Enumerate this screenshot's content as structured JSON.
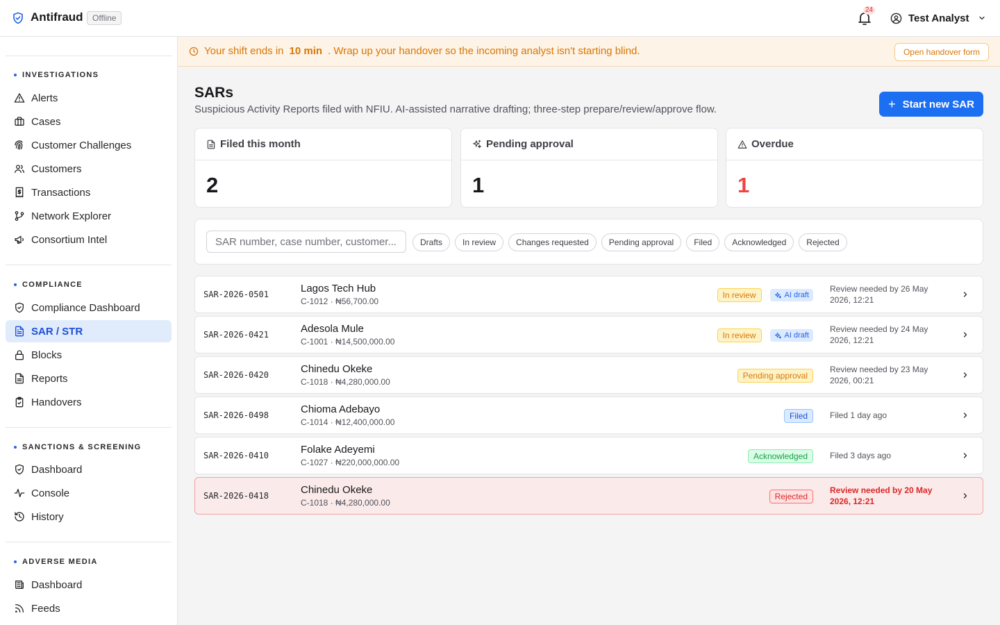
{
  "app": {
    "name": "Antifraud",
    "status_badge": "Offline"
  },
  "header": {
    "notification_count": "24",
    "user_name": "Test Analyst"
  },
  "sidebar": {
    "sections": [
      {
        "title": "INVESTIGATIONS",
        "items": [
          {
            "label": "Alerts",
            "icon": "alert-triangle-icon"
          },
          {
            "label": "Cases",
            "icon": "briefcase-icon"
          },
          {
            "label": "Customer Challenges",
            "icon": "fingerprint-icon"
          },
          {
            "label": "Customers",
            "icon": "users-icon"
          },
          {
            "label": "Transactions",
            "icon": "receipt-dollar-icon"
          },
          {
            "label": "Network Explorer",
            "icon": "git-branch-icon"
          },
          {
            "label": "Consortium Intel",
            "icon": "megaphone-icon"
          }
        ]
      },
      {
        "title": "COMPLIANCE",
        "items": [
          {
            "label": "Compliance Dashboard",
            "icon": "shield-check-icon"
          },
          {
            "label": "SAR / STR",
            "icon": "file-text-icon",
            "active": true
          },
          {
            "label": "Blocks",
            "icon": "lock-icon"
          },
          {
            "label": "Reports",
            "icon": "file-lines-icon"
          },
          {
            "label": "Handovers",
            "icon": "clipboard-check-icon"
          }
        ]
      },
      {
        "title": "SANCTIONS & SCREENING",
        "items": [
          {
            "label": "Dashboard",
            "icon": "shield-check-icon"
          },
          {
            "label": "Console",
            "icon": "activity-icon"
          },
          {
            "label": "History",
            "icon": "history-icon"
          }
        ]
      },
      {
        "title": "ADVERSE MEDIA",
        "items": [
          {
            "label": "Dashboard",
            "icon": "newspaper-icon"
          },
          {
            "label": "Feeds",
            "icon": "rss-icon"
          }
        ]
      }
    ]
  },
  "banner": {
    "text_before": "Your shift ends in",
    "highlight": "10 min",
    "text_after": ". Wrap up your handover so the incoming analyst isn't starting blind.",
    "button": "Open handover form"
  },
  "page": {
    "title": "SARs",
    "subtitle": "Suspicious Activity Reports filed with NFIU. AI-assisted narrative drafting; three-step prepare/review/approve flow.",
    "new_button": "Start new SAR"
  },
  "stats": [
    {
      "label": "Filed this month",
      "value": "2",
      "icon": "file-icon"
    },
    {
      "label": "Pending approval",
      "value": "1",
      "icon": "sparkles-icon"
    },
    {
      "label": "Overdue",
      "value": "1",
      "icon": "alert-triangle-icon",
      "color": "#ef4444"
    }
  ],
  "filters": {
    "search_placeholder": "SAR number, case number, customer...",
    "chips": [
      "Drafts",
      "In review",
      "Changes requested",
      "Pending approval",
      "Filed",
      "Acknowledged",
      "Rejected"
    ]
  },
  "sars": [
    {
      "number": "SAR-2026-0501",
      "customer": "Lagos Tech Hub",
      "meta": "C-1012 · ₦56,700.00",
      "status": "In review",
      "ai": "AI draft",
      "when": "Review needed by 26 May 2026, 12:21"
    },
    {
      "number": "SAR-2026-0421",
      "customer": "Adesola Mule",
      "meta": "C-1001 · ₦14,500,000.00",
      "status": "In review",
      "ai": "AI draft",
      "when": "Review needed by 24 May 2026, 12:21"
    },
    {
      "number": "SAR-2026-0420",
      "customer": "Chinedu Okeke",
      "meta": "C-1018 · ₦4,280,000.00",
      "status": "Pending approval",
      "ai": "",
      "when": "Review needed by 23 May 2026, 00:21"
    },
    {
      "number": "SAR-2026-0498",
      "customer": "Chioma Adebayo",
      "meta": "C-1014 · ₦12,400,000.00",
      "status": "Filed",
      "ai": "",
      "when": "Filed 1 day ago"
    },
    {
      "number": "SAR-2026-0410",
      "customer": "Folake Adeyemi",
      "meta": "C-1027 · ₦220,000,000.00",
      "status": "Acknowledged",
      "ai": "",
      "when": "Filed 3 days ago"
    },
    {
      "number": "SAR-2026-0418",
      "customer": "Chinedu Okeke",
      "meta": "C-1018 · ₦4,280,000.00",
      "status": "Rejected",
      "ai": "",
      "when": "Review needed by 20 May 2026, 12:21"
    }
  ],
  "colors": {
    "accent": "#1d6ff2",
    "danger": "#ef4444",
    "warning": "#d97706",
    "success": "#16a34a"
  }
}
